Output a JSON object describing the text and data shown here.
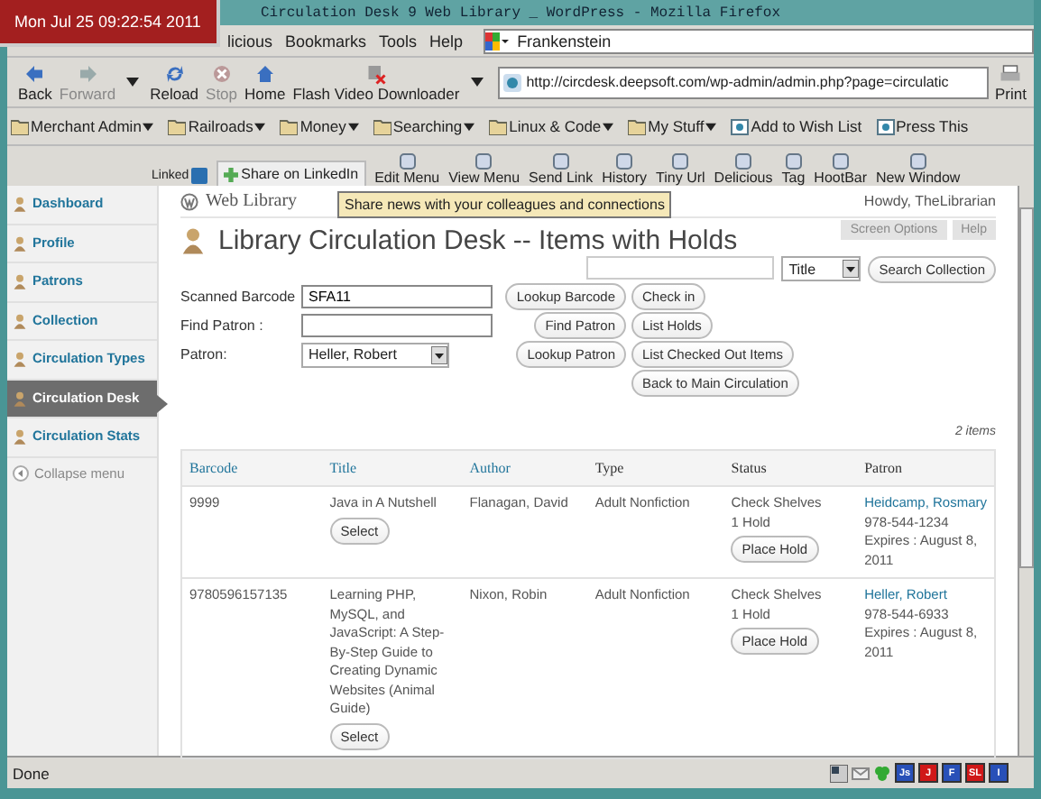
{
  "window": {
    "title": "Circulation Desk  9 Web Library  _ WordPress - Mozilla Firefox"
  },
  "clock": "Mon Jul 25 09:22:54 2011",
  "menu": [
    "licious",
    "Bookmarks",
    "Tools",
    "Help"
  ],
  "search_bar": {
    "value": "Frankenstein"
  },
  "nav_buttons": [
    {
      "label": "Back",
      "kind": "back",
      "disabled": false
    },
    {
      "label": "Forward",
      "kind": "forward",
      "disabled": true
    },
    {
      "label": "Reload",
      "kind": "reload",
      "disabled": false
    },
    {
      "label": "Stop",
      "kind": "stop",
      "disabled": true
    },
    {
      "label": "Home",
      "kind": "home",
      "disabled": false
    },
    {
      "label": "Flash Video Downloader",
      "kind": "download",
      "disabled": false
    }
  ],
  "url": "http://circdesk.deepsoft.com/wp-admin/admin.php?page=circulatic",
  "print": "Print",
  "bookmarks": [
    {
      "label": "Merchant Admin",
      "kind": "folder"
    },
    {
      "label": "Railroads",
      "kind": "folder"
    },
    {
      "label": "Money",
      "kind": "folder"
    },
    {
      "label": "Searching",
      "kind": "folder"
    },
    {
      "label": "Linux & Code",
      "kind": "folder"
    },
    {
      "label": "My Stuff",
      "kind": "folder"
    },
    {
      "label": "Add to Wish List",
      "kind": "bookmarklet"
    },
    {
      "label": "Press This",
      "kind": "bookmarklet"
    }
  ],
  "extension_toolbar": {
    "linkedin": "Linked",
    "share": "Share on LinkedIn",
    "items": [
      "Edit Menu",
      "View Menu",
      "Send Link",
      "History",
      "Tiny Url",
      "Delicious",
      "Tag",
      "HootBar",
      "New Window"
    ]
  },
  "tooltip": "Share news with your colleagues and connections",
  "sidebar": {
    "items": [
      {
        "label": "Dashboard",
        "selected": false
      },
      {
        "label": "Profile",
        "selected": false
      },
      {
        "label": "Patrons",
        "selected": false
      },
      {
        "label": "Collection",
        "selected": false
      },
      {
        "label": "Circulation Types",
        "selected": false
      },
      {
        "label": "Circulation Desk",
        "selected": true
      },
      {
        "label": "Circulation Stats",
        "selected": false
      }
    ],
    "collapse": "Collapse menu"
  },
  "site_title": "Web Library",
  "howdy": "Howdy, TheLibrarian",
  "screen_options": "Screen Options",
  "help": "Help",
  "heading": "Library Circulation Desk -- Items with Holds",
  "collection_search": {
    "field_select": "Title",
    "button": "Search Collection"
  },
  "form": {
    "barcode_label": "Scanned Barcode",
    "barcode_value": "SFA11",
    "find_label": "Find Patron :",
    "patron_label": "Patron:",
    "patron_value": "Heller, Robert",
    "buttons": [
      "Lookup Barcode",
      "Check in",
      "Find Patron",
      "List Holds",
      "Lookup Patron",
      "List Checked Out Items",
      "Back to Main Circulation"
    ]
  },
  "item_count": "2 items",
  "table": {
    "columns": [
      "Barcode",
      "Title",
      "Author",
      "Type",
      "Status",
      "Patron"
    ],
    "rows": [
      {
        "barcode": "9999",
        "title": "Java in A Nutshell",
        "select": "Select",
        "author": "Flanagan, David",
        "type": "Adult Nonfiction",
        "status": "Check Shelves",
        "holds": "1 Hold",
        "place_hold": "Place Hold",
        "patron": "Heidcamp, Rosmary",
        "phone": "978-544-1234",
        "expires": "Expires : August 8, 2011"
      },
      {
        "barcode": "9780596157135",
        "title": "Learning PHP, MySQL, and JavaScript: A Step-By-Step Guide to Creating Dynamic Websites (Animal Guide)",
        "select": "Select",
        "author": "Nixon, Robin",
        "type": "Adult Nonfiction",
        "status": "Check Shelves",
        "holds": "1 Hold",
        "place_hold": "Place Hold",
        "patron": "Heller, Robert",
        "phone": "978-544-6933",
        "expires": "Expires : August 8, 2011"
      }
    ]
  },
  "status_bar": {
    "text": "Done",
    "badges": [
      {
        "label": "Js",
        "color": "#2850b8"
      },
      {
        "label": "J",
        "color": "#d01818"
      },
      {
        "label": "F",
        "color": "#2850b8"
      },
      {
        "label": "SL",
        "color": "#d01818"
      },
      {
        "label": "I",
        "color": "#2850b8"
      }
    ]
  }
}
